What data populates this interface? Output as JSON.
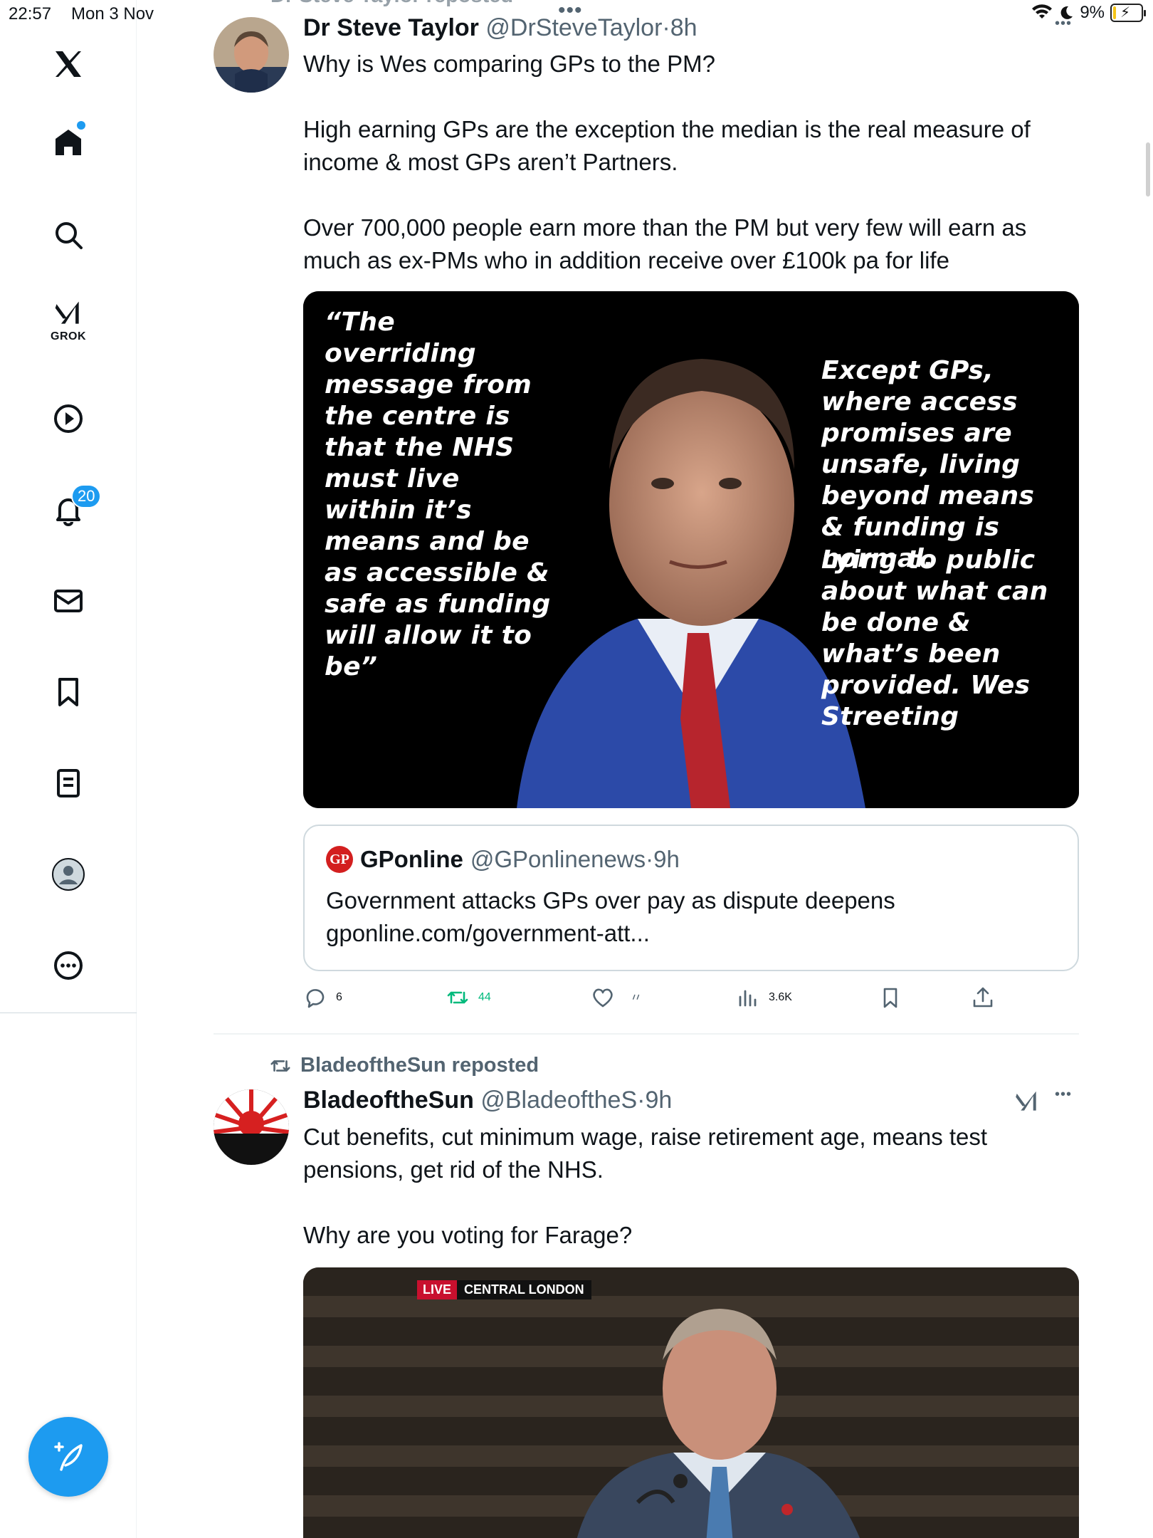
{
  "status_bar": {
    "time": "22:57",
    "date": "Mon 3 Nov",
    "battery": "9%",
    "battery_level": 0.09
  },
  "sidebar": {
    "grok_label": "GROK",
    "notifications_count": "20"
  },
  "tweets": [
    {
      "repost_by": "Dr Steve Taylor reposted",
      "name": "Dr Steve Taylor",
      "handle": "@DrSteveTaylor",
      "sep": "·",
      "time": "8h",
      "paragraphs": [
        "Why is Wes comparing GPs to the PM?",
        "High earning GPs are the exception the median is the real measure of income & most GPs aren’t Partners.",
        "Over 700,000 people earn more than the PM but very few will earn as much as ex-PMs who in addition receive over £100k pa for life"
      ],
      "image_text_left": "“The overriding message from the centre is that the NHS must live within it’s means and be as accessible & safe as funding will allow it to be”",
      "image_text_right_1": "Except GPs, where access promises are unsafe, living beyond means & funding is normal.",
      "image_text_right_2": "Lying to public about what can be done & what’s been provided. Wes Streeting",
      "quote": {
        "logo_text": "GP",
        "name": "GPonline",
        "handle": "@GPonlinenews",
        "sep": "·",
        "time": "9h",
        "text": "Government attacks GPs over pay as dispute deepens",
        "link": "gponline.com/government-att..."
      },
      "actions": {
        "replies": "6",
        "reposts": "44",
        "likes": "",
        "views": "3.6K"
      }
    },
    {
      "repost_by": "BladeoftheSun reposted",
      "name": "BladeoftheSun",
      "handle": "@BladeoftheS",
      "sep": "·",
      "time": "9h",
      "paragraphs": [
        "Cut benefits, cut minimum wage, raise retirement age, means test pensions, get rid of the NHS.",
        "Why are you voting for Farage?"
      ],
      "video_tag_live": "LIVE",
      "video_tag_location": "CENTRAL LONDON"
    }
  ],
  "colors": {
    "accent": "#1d9bf0",
    "repost_green": "#00ba7c",
    "secondary_text": "#536471"
  }
}
